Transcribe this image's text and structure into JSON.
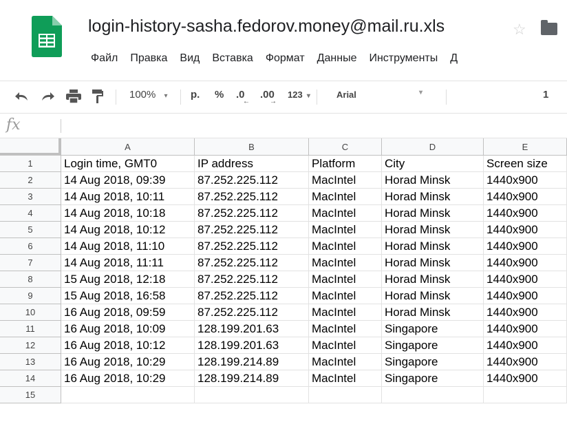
{
  "doc": {
    "title": "login-history-sasha.fedorov.money@mail.ru.xls",
    "star": "☆"
  },
  "menu": [
    "Файл",
    "Правка",
    "Вид",
    "Вставка",
    "Формат",
    "Данные",
    "Инструменты",
    "Д"
  ],
  "toolbar": {
    "zoom": "100%",
    "currency": "р.",
    "percent": "%",
    "dec_less": ".0",
    "dec_more": ".00",
    "format_more": "123",
    "font": "Arial",
    "font_size": "1"
  },
  "formula_bar": {
    "fx": "fx",
    "value": ""
  },
  "columns": [
    "A",
    "B",
    "C",
    "D",
    "E"
  ],
  "rows": [
    {
      "n": "1",
      "cells": [
        "Login time, GMT0",
        "IP address",
        "Platform",
        "City",
        "Screen size"
      ]
    },
    {
      "n": "2",
      "cells": [
        "14 Aug 2018, 09:39",
        "87.252.225.112",
        "MacIntel",
        "Horad Minsk",
        "1440x900"
      ]
    },
    {
      "n": "3",
      "cells": [
        "14 Aug 2018, 10:11",
        "87.252.225.112",
        "MacIntel",
        "Horad Minsk",
        "1440x900"
      ]
    },
    {
      "n": "4",
      "cells": [
        "14 Aug 2018, 10:18",
        "87.252.225.112",
        "MacIntel",
        "Horad Minsk",
        "1440x900"
      ]
    },
    {
      "n": "5",
      "cells": [
        "14 Aug 2018, 10:12",
        "87.252.225.112",
        "MacIntel",
        "Horad Minsk",
        "1440x900"
      ]
    },
    {
      "n": "6",
      "cells": [
        "14 Aug 2018, 11:10",
        "87.252.225.112",
        "MacIntel",
        "Horad Minsk",
        "1440x900"
      ]
    },
    {
      "n": "7",
      "cells": [
        "14 Aug 2018, 11:11",
        "87.252.225.112",
        "MacIntel",
        "Horad Minsk",
        "1440x900"
      ]
    },
    {
      "n": "8",
      "cells": [
        "15 Aug 2018, 12:18",
        "87.252.225.112",
        "MacIntel",
        "Horad Minsk",
        "1440x900"
      ]
    },
    {
      "n": "9",
      "cells": [
        "15 Aug 2018, 16:58",
        "87.252.225.112",
        "MacIntel",
        "Horad Minsk",
        "1440x900"
      ]
    },
    {
      "n": "10",
      "cells": [
        "16 Aug 2018, 09:59",
        "87.252.225.112",
        "MacIntel",
        "Horad Minsk",
        "1440x900"
      ]
    },
    {
      "n": "11",
      "cells": [
        "16 Aug 2018, 10:09",
        "128.199.201.63",
        "MacIntel",
        "Singapore",
        "1440x900"
      ]
    },
    {
      "n": "12",
      "cells": [
        "16 Aug 2018, 10:12",
        "128.199.201.63",
        "MacIntel",
        "Singapore",
        "1440x900"
      ]
    },
    {
      "n": "13",
      "cells": [
        "16 Aug 2018, 10:29",
        "128.199.214.89",
        "MacIntel",
        "Singapore",
        "1440x900"
      ]
    },
    {
      "n": "14",
      "cells": [
        "16 Aug 2018, 10:29",
        "128.199.214.89",
        "MacIntel",
        "Singapore",
        "1440x900"
      ]
    },
    {
      "n": "15",
      "cells": [
        "",
        "",
        "",
        "",
        ""
      ]
    }
  ],
  "colors": {
    "sheets_green": "#0f9d58",
    "header_bg": "#f8f9fa"
  }
}
